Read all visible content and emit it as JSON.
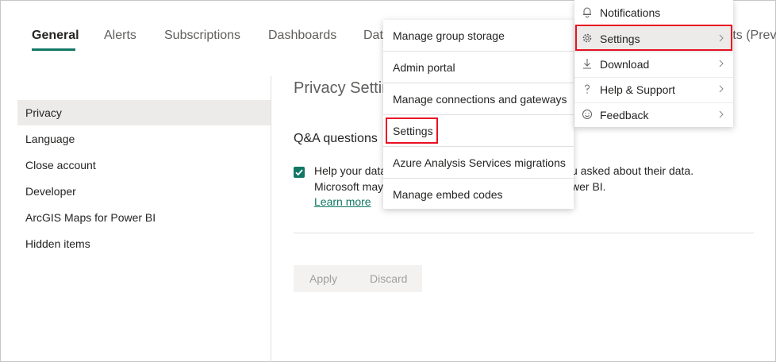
{
  "tabs": [
    {
      "label": "General"
    },
    {
      "label": "Alerts"
    },
    {
      "label": "Subscriptions"
    },
    {
      "label": "Dashboards"
    },
    {
      "label": "Dat"
    }
  ],
  "tab_right_partial": "rts (Prev",
  "sidebar": {
    "items": [
      {
        "label": "Privacy"
      },
      {
        "label": "Language"
      },
      {
        "label": "Close account"
      },
      {
        "label": "Developer"
      },
      {
        "label": "ArcGIS Maps for Power BI"
      },
      {
        "label": "Hidden items"
      }
    ]
  },
  "main": {
    "page_title": "Privacy Settin",
    "section_title": "Q&A questions",
    "description_line1_start": "Help your data",
    "description_line1_end": "u asked about their data.",
    "description_line2_start": "Microsoft may",
    "description_line2_end": "wer BI.",
    "learn_more": "Learn more",
    "apply_label": "Apply",
    "discard_label": "Discard",
    "checkbox_checked": true
  },
  "admin_menu": {
    "items": [
      {
        "label": "Manage group storage"
      },
      {
        "label": "Admin portal"
      },
      {
        "label": "Manage connections and gateways"
      },
      {
        "label": "Settings"
      },
      {
        "label": "Azure Analysis Services migrations"
      },
      {
        "label": "Manage embed codes"
      }
    ]
  },
  "settings_menu": {
    "items": [
      {
        "label": "Notifications",
        "icon": "bell-icon"
      },
      {
        "label": "Settings",
        "icon": "gear-icon"
      },
      {
        "label": "Download",
        "icon": "download-icon"
      },
      {
        "label": "Help & Support",
        "icon": "question-icon"
      },
      {
        "label": "Feedback",
        "icon": "smiley-icon"
      }
    ]
  },
  "colors": {
    "accent": "#117865",
    "highlight_border": "#e81123",
    "selected_bg": "#edebe9"
  }
}
